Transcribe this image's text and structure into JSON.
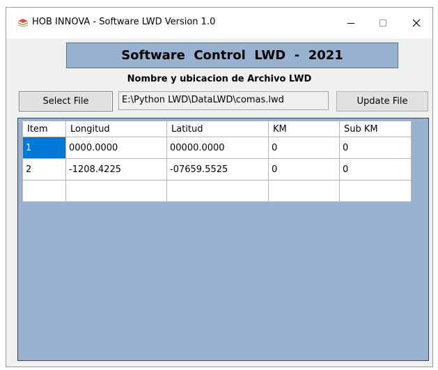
{
  "window": {
    "title": "HOB INNOVA - Software LWD Version 1.0"
  },
  "header": {
    "banner": "Software  Control  LWD  -  2021",
    "subtitle": "Nombre y ubicacion de Archivo LWD"
  },
  "controls": {
    "select_file_label": "Select File",
    "file_path_value": "E:\\Python LWD\\DataLWD\\comas.lwd",
    "update_file_label": "Update File"
  },
  "grid": {
    "columns": [
      "Item",
      "Longitud",
      "Latitud",
      "KM",
      "Sub KM"
    ],
    "rows": [
      [
        "1",
        "0000.0000",
        "00000.0000",
        "0",
        "0"
      ],
      [
        "2",
        "-1208.4225",
        "-07659.5525",
        "0",
        "0"
      ],
      [
        "",
        "",
        "",
        "",
        ""
      ]
    ]
  },
  "icons": {
    "app": "stacked-layers-icon",
    "minimize": "minimize-icon",
    "maximize": "maximize-icon",
    "close": "close-icon"
  },
  "colors": {
    "banner_bg": "#98b2cf",
    "grid_bg": "#98b2cf",
    "selection": "#0078d7"
  }
}
